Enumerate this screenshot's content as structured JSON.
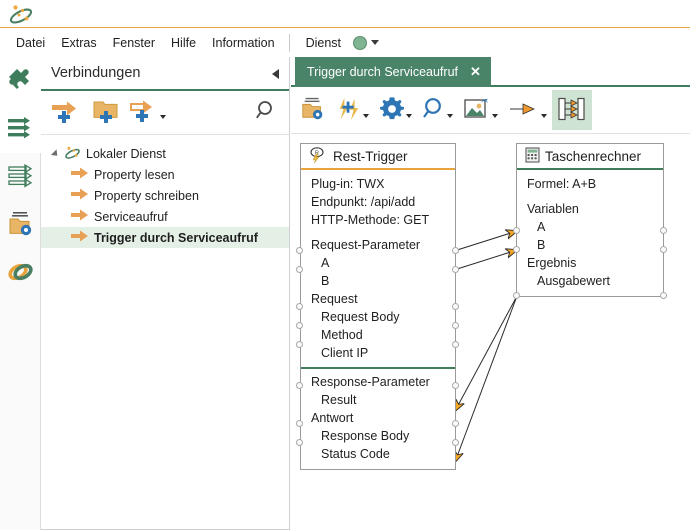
{
  "app": {
    "logo_icon": "orbit-logo-icon"
  },
  "menu": {
    "items": [
      "Datei",
      "Extras",
      "Fenster",
      "Hilfe",
      "Information"
    ],
    "service": {
      "label": "Dienst",
      "status_color": "#7fb391",
      "dropdown_icon": "caret-down-icon"
    }
  },
  "rail": {
    "items": [
      {
        "name": "plugins",
        "icon": "puzzle-piece-icon",
        "selected": true
      },
      {
        "name": "connections",
        "icon": "filled-arrow-list-icon",
        "selected": true
      },
      {
        "name": "services",
        "icon": "outline-arrow-list-icon",
        "selected": false
      },
      {
        "name": "settings-folder",
        "icon": "folder-gear-icon",
        "selected": false
      },
      {
        "name": "links",
        "icon": "linked-rings-icon",
        "selected": false
      }
    ]
  },
  "connections_panel": {
    "title": "Verbindungen",
    "collapse_icon": "collapse-left-icon",
    "toolbar": [
      {
        "name": "add-connection",
        "icon": "arrow-plus-icon",
        "has_caret": false
      },
      {
        "name": "add-folder",
        "icon": "folder-plus-icon",
        "has_caret": false
      },
      {
        "name": "add-trigger",
        "icon": "trigger-plus-icon",
        "has_caret": true
      }
    ],
    "search_icon": "search-icon",
    "tree": {
      "root": {
        "label": "Lokaler Dienst",
        "icon": "orbit-logo-icon",
        "expanded": true
      },
      "children": [
        {
          "label": "Property lesen",
          "icon": "arrow-right-icon",
          "selected": false
        },
        {
          "label": "Property schreiben",
          "icon": "arrow-right-icon",
          "selected": false
        },
        {
          "label": "Serviceaufruf",
          "icon": "arrow-right-icon",
          "selected": false
        },
        {
          "label": "Trigger durch Serviceaufruf",
          "icon": "arrow-right-icon",
          "selected": true
        }
      ]
    }
  },
  "editor": {
    "tab": {
      "label": "Trigger durch Serviceaufruf",
      "close_icon": "close-icon"
    },
    "toolbar": [
      {
        "name": "open-folder-settings",
        "icon": "folder-gear-icon",
        "has_caret": false,
        "active": false
      },
      {
        "name": "flash-tools",
        "icon": "lightning-plus-icon",
        "has_caret": true,
        "active": false
      },
      {
        "name": "configure",
        "icon": "gear-icon",
        "has_caret": true,
        "active": false
      },
      {
        "name": "zoom",
        "icon": "search-icon",
        "has_caret": true,
        "active": false
      },
      {
        "name": "export-image",
        "icon": "image-export-icon",
        "has_caret": true,
        "active": false
      },
      {
        "name": "connection-line",
        "icon": "line-arrow-icon",
        "has_caret": true,
        "active": false
      },
      {
        "name": "show-connections",
        "icon": "connections-panel-icon",
        "has_caret": false,
        "active": true
      }
    ]
  },
  "diagram": {
    "nodes": [
      {
        "id": "rest-trigger",
        "title": "Rest-Trigger",
        "icon": "rest-trigger-icon",
        "accent": "#e8a33d",
        "rows": [
          {
            "text": "Plug-in: TWX",
            "style": "plain",
            "port_left": false,
            "port_right": false
          },
          {
            "text": "Endpunkt: /api/add",
            "style": "plain",
            "port_left": false,
            "port_right": false
          },
          {
            "text": "HTTP-Methode: GET",
            "style": "plain",
            "port_left": false,
            "port_right": false
          },
          {
            "text": "Request-Parameter",
            "style": "group",
            "port_left": false,
            "port_right": false
          },
          {
            "text": "A",
            "style": "item",
            "port_left": true,
            "port_right": true
          },
          {
            "text": "B",
            "style": "item",
            "port_left": true,
            "port_right": true
          },
          {
            "text": "Request",
            "style": "group",
            "port_left": false,
            "port_right": false
          },
          {
            "text": "Request Body",
            "style": "item",
            "port_left": true,
            "port_right": true
          },
          {
            "text": "Method",
            "style": "item",
            "port_left": true,
            "port_right": true
          },
          {
            "text": "Client IP",
            "style": "item",
            "port_left": true,
            "port_right": true
          },
          {
            "text": "",
            "style": "separator",
            "port_left": false,
            "port_right": false
          },
          {
            "text": "Response-Parameter",
            "style": "group",
            "port_left": false,
            "port_right": false
          },
          {
            "text": "Result",
            "style": "item",
            "port_left": true,
            "port_right": true
          },
          {
            "text": "Antwort",
            "style": "group",
            "port_left": false,
            "port_right": false
          },
          {
            "text": "Response Body",
            "style": "item",
            "port_left": true,
            "port_right": true
          },
          {
            "text": "Status Code",
            "style": "item",
            "port_left": true,
            "port_right": true
          }
        ]
      },
      {
        "id": "taschenrechner",
        "title": "Taschenrechner",
        "icon": "calculator-icon",
        "accent": "#3f7d5c",
        "rows": [
          {
            "text": "Formel: A+B",
            "style": "plain",
            "port_left": false,
            "port_right": false
          },
          {
            "text": "Variablen",
            "style": "group",
            "port_left": false,
            "port_right": false
          },
          {
            "text": "A",
            "style": "item",
            "port_left": true,
            "port_right": true
          },
          {
            "text": "B",
            "style": "item",
            "port_left": true,
            "port_right": true
          },
          {
            "text": "Ergebnis",
            "style": "group",
            "port_left": false,
            "port_right": false
          },
          {
            "text": "Ausgabewert",
            "style": "item",
            "port_left": true,
            "port_right": true
          }
        ]
      }
    ],
    "edges": [
      {
        "from": "rest-trigger.A.out",
        "to": "taschenrechner.A.in"
      },
      {
        "from": "rest-trigger.B.out",
        "to": "taschenrechner.B.in"
      },
      {
        "from": "taschenrechner.Ausgabewert.in",
        "to": "rest-trigger.Result.out"
      },
      {
        "from": "taschenrechner.Ausgabewert.in",
        "to": "rest-trigger.Response Body.out"
      }
    ],
    "edge_color": "#2b2b2b",
    "arrow_color": "#f5a623"
  }
}
